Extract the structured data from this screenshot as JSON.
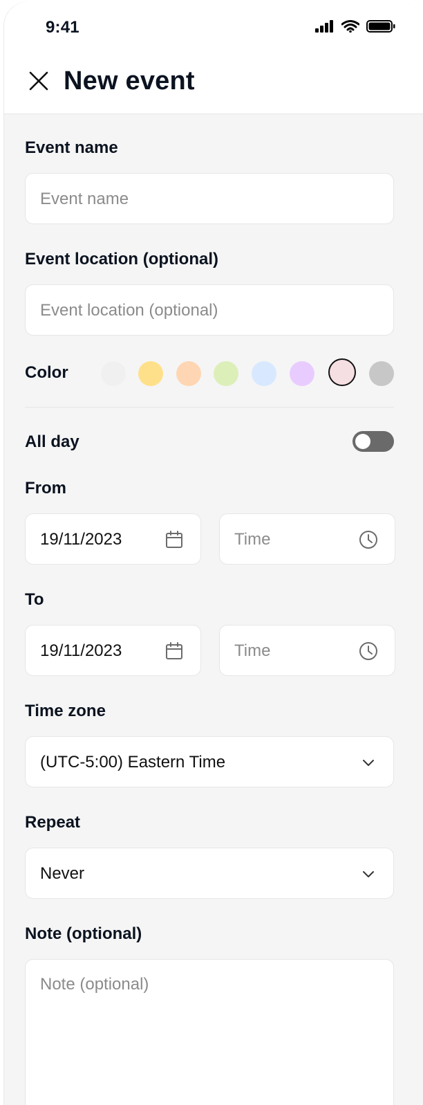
{
  "status": {
    "time": "9:41"
  },
  "header": {
    "title": "New event"
  },
  "form": {
    "event_name": {
      "label": "Event name",
      "placeholder": "Event name"
    },
    "event_location": {
      "label": "Event location (optional)",
      "placeholder": "Event location (optional)"
    },
    "color": {
      "label": "Color",
      "options": [
        "#f0f0f0",
        "#ffe08a",
        "#ffd6b3",
        "#dcefb9",
        "#d8e8ff",
        "#e8ccff",
        "#f6dfe2",
        "#c7c7c7"
      ],
      "selected_index": 6
    },
    "all_day": {
      "label": "All day",
      "enabled": false
    },
    "from": {
      "label": "From",
      "date": "19/11/2023",
      "time_placeholder": "Time"
    },
    "to": {
      "label": "To",
      "date": "19/11/2023",
      "time_placeholder": "Time"
    },
    "time_zone": {
      "label": "Time zone",
      "value": "(UTC-5:00) Eastern Time"
    },
    "repeat": {
      "label": "Repeat",
      "value": "Never"
    },
    "note": {
      "label": "Note (optional)",
      "placeholder": "Note (optional)"
    }
  },
  "icons": {
    "close": "close-icon",
    "calendar": "calendar-icon",
    "clock": "clock-icon",
    "chevron": "chevron-down-icon",
    "signal": "cellular-signal-icon",
    "wifi": "wifi-icon",
    "battery": "battery-icon"
  }
}
